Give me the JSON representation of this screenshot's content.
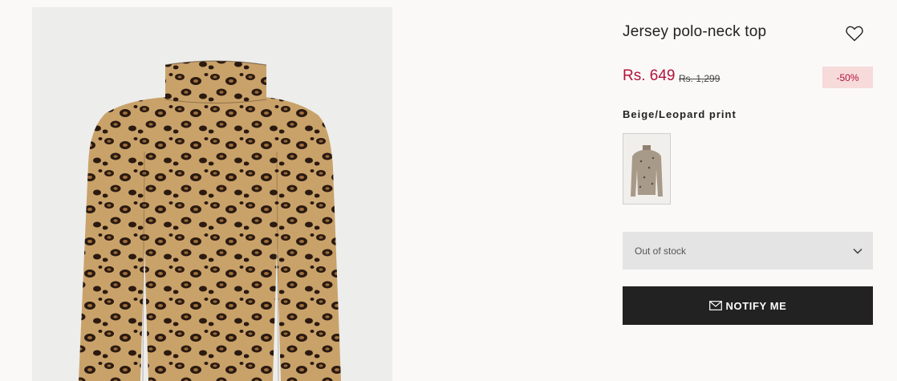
{
  "product": {
    "title": "Jersey polo-neck top",
    "price_current": "Rs. 649",
    "price_old": "Rs. 1,299",
    "discount": "-50%",
    "color_name": "Beige/Leopard print"
  },
  "size_selector": {
    "value": "Out of stock"
  },
  "actions": {
    "notify_label": "NOTIFY ME"
  },
  "icons": {
    "favorite": "heart-icon",
    "dropdown": "chevron-down-icon",
    "notify": "mail-icon"
  },
  "colors": {
    "accent": "#b3123a",
    "discount_bg": "#f7dada",
    "button_bg": "#222222",
    "select_bg": "#e4e4e4"
  }
}
